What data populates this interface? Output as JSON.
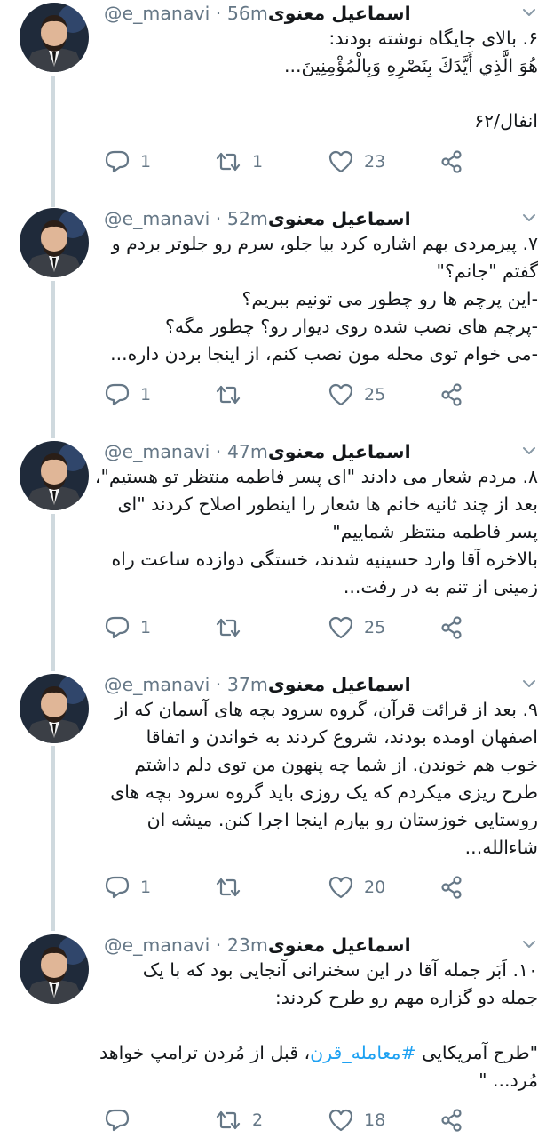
{
  "thread": {
    "tweets": [
      {
        "name": "اسماعیل معنوی",
        "handle": "@e_manavi",
        "time": "56m",
        "lines": [
          "۶. بالای جایگاه نوشته بودند:",
          "هُوَ الَّذِي أَيَّدَكَ بِنَصْرِهِ وَبِالْمُؤْمِنِينَ...",
          "",
          "انفال/۶۲"
        ],
        "replies": "1",
        "retweets": "1",
        "likes": "23"
      },
      {
        "name": "اسماعیل معنوی",
        "handle": "@e_manavi",
        "time": "52m",
        "lines": [
          "۷. پیرمردی بهم اشاره کرد بیا جلو، سرم رو جلوتر بردم و",
          "گفتم \"جانم؟\"",
          "-این پرچم ها رو چطور می تونیم ببریم؟",
          "-پرچم های نصب شده روی دیوار رو؟ چطور مگه؟",
          "-می خوام توی محله مون نصب کنم، از اینجا بردن داره..."
        ],
        "replies": "1",
        "retweets": "",
        "likes": "25"
      },
      {
        "name": "اسماعیل معنوی",
        "handle": "@e_manavi",
        "time": "47m",
        "lines": [
          "۸. مردم شعار می دادند \"ای پسر فاطمه منتظر تو هستیم\"،",
          "بعد از چند ثانیه خانم ها شعار را اینطور اصلاح کردند \"ای",
          "پسر فاطمه منتظر شماییم\"",
          "بالاخره آقا وارد حسینیه شدند، خستگی دوازده ساعت راه",
          "زمینی از تنم به در رفت..."
        ],
        "replies": "1",
        "retweets": "",
        "likes": "25"
      },
      {
        "name": "اسماعیل معنوی",
        "handle": "@e_manavi",
        "time": "37m",
        "lines": [
          "۹. بعد از قرائت قرآن، گروه سرود بچه های آسمان که از",
          "اصفهان اومده بودند، شروع کردند به خواندن و اتفاقا",
          "خوب هم خوندن. از شما چه پنهون من توی دلم داشتم",
          "طرح ریزی میکردم که یک روزی باید گروه سرود بچه های",
          "روستایی خوزستان رو بیارم اینجا اجرا کنن. میشه ان",
          "شاءالله..."
        ],
        "replies": "1",
        "retweets": "",
        "likes": "20"
      },
      {
        "name": "اسماعیل معنوی",
        "handle": "@e_manavi",
        "time": "23m",
        "lines": [
          "۱۰. اَبَر جمله آقا در این سخنرانی آنجایی بود که با یک",
          "جمله دو گزاره مهم رو طرح کردند:",
          ""
        ],
        "last_line_prefix": "\"طرح آمریکایی ",
        "last_line_hashtag": "#معامله_قرن",
        "last_line_suffix": "، قبل از مُردن ترامپ خواهد",
        "final_line": "مُرد... \"",
        "replies": "",
        "retweets": "2",
        "likes": "18"
      }
    ]
  },
  "colors": {
    "text": "#14171a",
    "secondary": "#657786",
    "link": "#1da1f2",
    "thread_line": "#cfd9de"
  },
  "icons": {
    "reply": "speech-bubble",
    "retweet": "retweet-arrows",
    "like": "heart-outline",
    "share": "share-nodes",
    "caret": "chevron-down"
  }
}
